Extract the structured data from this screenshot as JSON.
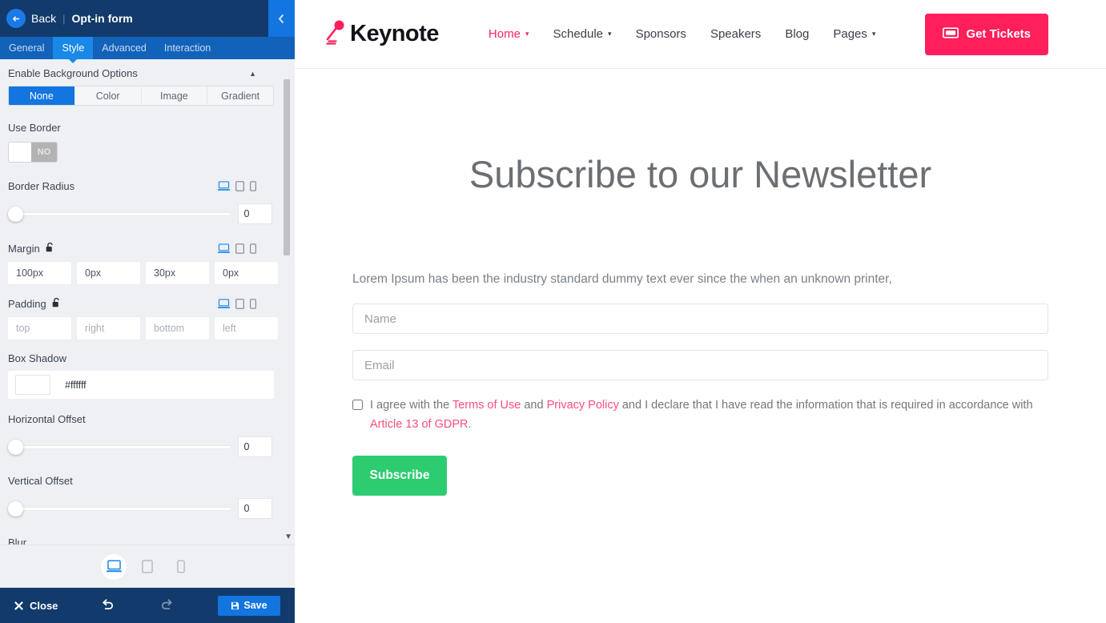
{
  "editor": {
    "header": {
      "back_label": "Back",
      "divider": "|",
      "title": "Opt-in form",
      "back_icon": "arrow-left-icon",
      "collapse_icon": "chevron-left-icon"
    },
    "tabs": [
      {
        "label": "General",
        "active": false
      },
      {
        "label": "Style",
        "active": true
      },
      {
        "label": "Advanced",
        "active": false
      },
      {
        "label": "Interaction",
        "active": false
      }
    ],
    "background_section": {
      "title": "Enable Background Options",
      "collapse_caret": "▲",
      "options": [
        "None",
        "Color",
        "Image",
        "Gradient"
      ],
      "selected": "None"
    },
    "use_border": {
      "label": "Use Border",
      "value": "NO"
    },
    "border_radius": {
      "label": "Border Radius",
      "value": "0",
      "slider_percent": 0
    },
    "margin": {
      "label": "Margin",
      "lock_icon": "unlock-icon",
      "values": [
        "100px",
        "0px",
        "30px",
        "0px"
      ],
      "placeholders": [
        "top",
        "right",
        "bottom",
        "left"
      ]
    },
    "padding": {
      "label": "Padding",
      "lock_icon": "unlock-icon",
      "values": [
        "",
        "",
        "",
        ""
      ],
      "placeholders": [
        "top",
        "right",
        "bottom",
        "left"
      ]
    },
    "box_shadow": {
      "label": "Box Shadow",
      "color_hex": "#ffffff"
    },
    "horizontal_offset": {
      "label": "Horizontal Offset",
      "value": "0",
      "slider_percent": 0
    },
    "vertical_offset": {
      "label": "Vertical Offset",
      "value": "0",
      "slider_percent": 0
    },
    "blur": {
      "label": "Blur"
    },
    "device_icons": [
      "desktop-icon",
      "tablet-icon",
      "mobile-icon"
    ],
    "device_active": "desktop-icon",
    "footer": {
      "close_label": "Close",
      "close_icon": "x-icon",
      "undo_icon": "undo-icon",
      "redo_icon": "redo-icon",
      "save_label": "Save",
      "save_icon": "floppy-disk-icon"
    },
    "scroll_down_caret": "▼"
  },
  "colors": {
    "panel_bg": "#eef0f4",
    "header_navy": "#123a6b",
    "tabbar_blue": "#1262b9",
    "active_blue": "#1a88e8",
    "primary_blue": "#1275e0",
    "brand_pink": "#ff1f5a",
    "link_pink": "#ff4d7e",
    "subscribe_green": "#2ecc71"
  },
  "site": {
    "logo": {
      "text": "Keynote",
      "icon": "microphone-icon"
    },
    "nav": [
      {
        "label": "Home",
        "has_caret": true,
        "active": true
      },
      {
        "label": "Schedule",
        "has_caret": true,
        "active": false
      },
      {
        "label": "Sponsors",
        "has_caret": false,
        "active": false
      },
      {
        "label": "Speakers",
        "has_caret": false,
        "active": false
      },
      {
        "label": "Blog",
        "has_caret": false,
        "active": false
      },
      {
        "label": "Pages",
        "has_caret": true,
        "active": false
      }
    ],
    "tickets_button": {
      "label": "Get Tickets",
      "icon": "ticket-icon"
    },
    "headline": "Subscribe to our Newsletter",
    "form": {
      "intro": "Lorem Ipsum has been the industry standard dummy text ever since the when an unknown printer,",
      "name_placeholder": "Name",
      "email_placeholder": "Email",
      "consent": {
        "part1": "I agree with the ",
        "link1": "Terms of Use",
        "part2": " and ",
        "link2": "Privacy Policy",
        "part3": " and I declare that I have read the information that is required in accordance with ",
        "link3": "Article 13 of GDPR",
        "part4": "."
      },
      "submit_label": "Subscribe"
    }
  }
}
